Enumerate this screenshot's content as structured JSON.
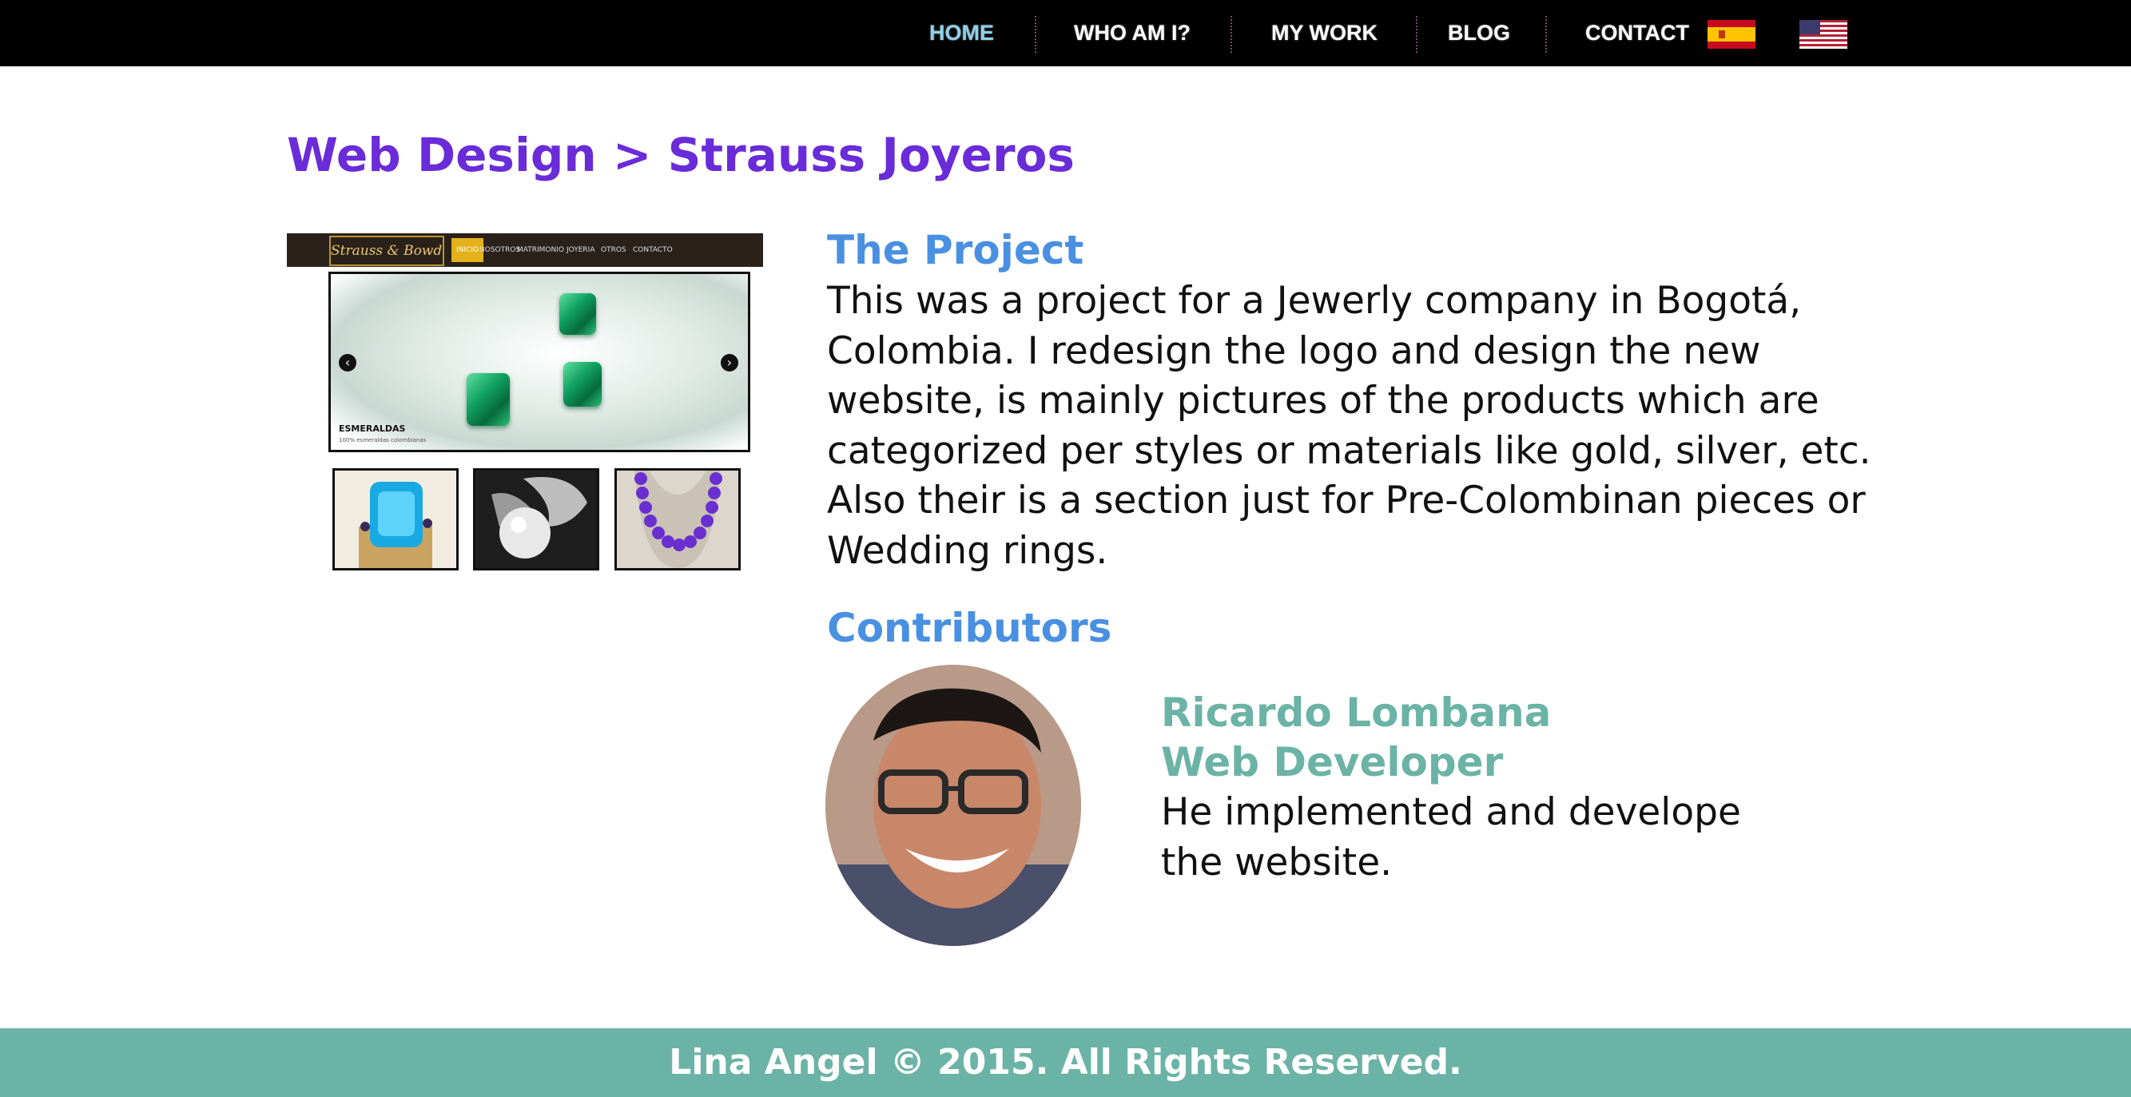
{
  "nav": {
    "items": [
      {
        "label": "HOME",
        "active": true
      },
      {
        "label": "WHO AM I?",
        "active": false
      },
      {
        "label": "MY WORK",
        "active": false
      },
      {
        "label": "BLOG",
        "active": false
      },
      {
        "label": "CONTACT",
        "active": false
      }
    ],
    "language_flags": [
      "spain-flag-icon",
      "usa-flag-icon"
    ],
    "active_color": "#8fd0ea"
  },
  "page": {
    "title": "Web Design > Strauss Joyeros",
    "title_color": "#6a2bd9"
  },
  "preview": {
    "logo_text": "Strauss & Bowden",
    "menu": [
      "INICIO",
      "NOSOTROS",
      "MATRIMONIO",
      "JOYERIA",
      "OTROS",
      "CONTACTO"
    ],
    "slide_caption": "ESMERALDAS",
    "slide_subcaption": "100% esmeraldas colombianas",
    "thumbnails": [
      "blue-topaz-ring",
      "pearl-ring",
      "purple-bead-necklace"
    ]
  },
  "project": {
    "heading": "The Project",
    "description": "This was a project for a Jewerly company in Bogotá, Colombia. I redesign the logo and design the new website, is mainly pictures of the products which are categorized per styles or materials like gold, silver, etc. Also their is a section just for Pre-Colombinan pieces or Wedding rings.",
    "heading_color": "#4a90e2"
  },
  "contributors": {
    "heading": "Contributors",
    "items": [
      {
        "name": "Ricardo Lombana",
        "role": "Web Developer",
        "description": "He implemented and develope the website."
      }
    ],
    "accent_color": "#6bb3a6"
  },
  "footer": {
    "text": "Lina Angel © 2015. All Rights Reserved.",
    "background": "#6bb3a6"
  }
}
